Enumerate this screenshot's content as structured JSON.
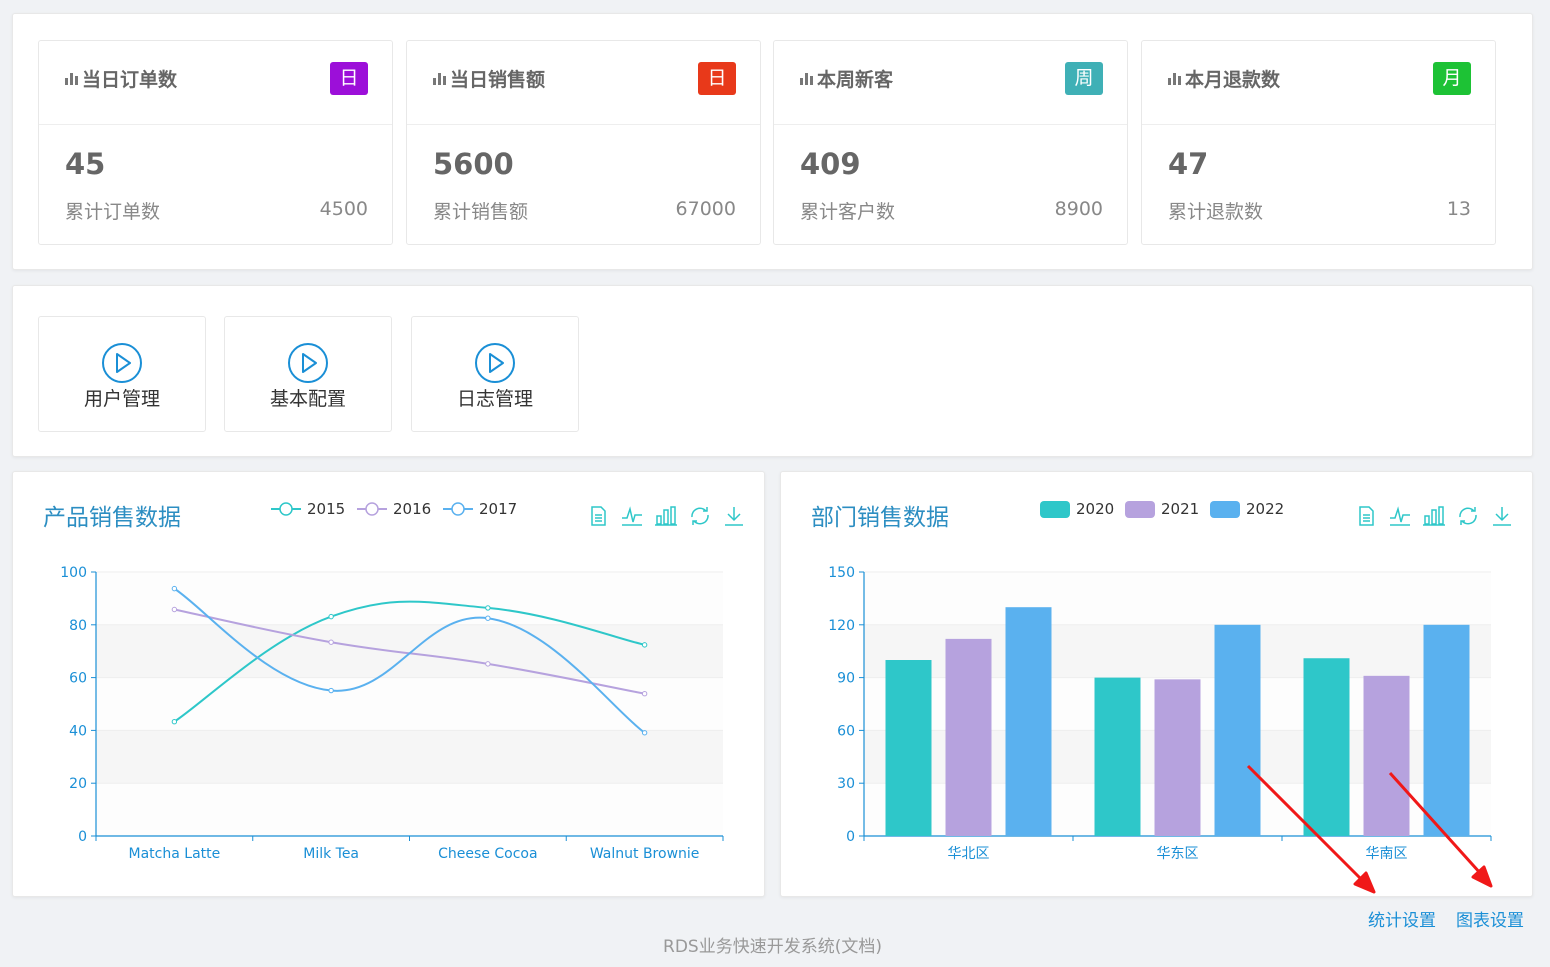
{
  "stats": [
    {
      "title": "当日订单数",
      "badge": "日",
      "badge_color": "#9c0fd9",
      "value": "45",
      "sub_label": "累计订单数",
      "sub_value": "4500"
    },
    {
      "title": "当日销售额",
      "badge": "日",
      "badge_color": "#e8391a",
      "value": "5600",
      "sub_label": "累计销售额",
      "sub_value": "67000"
    },
    {
      "title": "本周新客",
      "badge": "周",
      "badge_color": "#3fb0b6",
      "value": "409",
      "sub_label": "累计客户数",
      "sub_value": "8900"
    },
    {
      "title": "本月退款数",
      "badge": "月",
      "badge_color": "#1dc235",
      "value": "47",
      "sub_label": "累计退款数",
      "sub_value": "13"
    }
  ],
  "quick_links": [
    {
      "label": "用户管理",
      "icon": "play-circle-icon"
    },
    {
      "label": "基本配置",
      "icon": "play-circle-icon"
    },
    {
      "label": "日志管理",
      "icon": "play-circle-icon"
    }
  ],
  "colors": {
    "accent": "#2c8ec2",
    "link": "#1a8fd6",
    "arrow": "#f01818"
  },
  "toolbox_icons": [
    "data-view-icon",
    "line-switch-icon",
    "bar-switch-icon",
    "restore-icon",
    "save-image-icon"
  ],
  "chart_data": [
    {
      "type": "line",
      "title": "产品销售数据",
      "categories": [
        "Matcha Latte",
        "Milk Tea",
        "Cheese Cocoa",
        "Walnut Brownie"
      ],
      "series": [
        {
          "name": "2015",
          "values": [
            43.3,
            83.1,
            86.4,
            72.4
          ],
          "color": "#2ec7c9"
        },
        {
          "name": "2016",
          "values": [
            85.8,
            73.4,
            65.2,
            53.9
          ],
          "color": "#b6a2de"
        },
        {
          "name": "2017",
          "values": [
            93.7,
            55.1,
            82.5,
            39.1
          ],
          "color": "#5ab1ef"
        }
      ],
      "ylim": [
        0,
        100
      ],
      "yticks": [
        "0",
        "20",
        "40",
        "60",
        "80",
        "100"
      ],
      "smooth": true,
      "legend": "top",
      "grid": true
    },
    {
      "type": "bar",
      "title": "部门销售数据",
      "categories": [
        "华北区",
        "华东区",
        "华南区"
      ],
      "series": [
        {
          "name": "2020",
          "values": [
            100,
            90,
            101
          ],
          "color": "#2ec7c9"
        },
        {
          "name": "2021",
          "values": [
            112,
            89,
            91
          ],
          "color": "#b6a2de"
        },
        {
          "name": "2022",
          "values": [
            130,
            120,
            120
          ],
          "color": "#5ab1ef"
        }
      ],
      "ylim": [
        0,
        150
      ],
      "yticks": [
        "0",
        "30",
        "60",
        "90",
        "120",
        "150"
      ],
      "legend": "top",
      "grid": true
    }
  ],
  "footer": {
    "stat_settings": "统计设置",
    "chart_settings": "图表设置",
    "text": "RDS业务快速开发系统(文档)"
  }
}
